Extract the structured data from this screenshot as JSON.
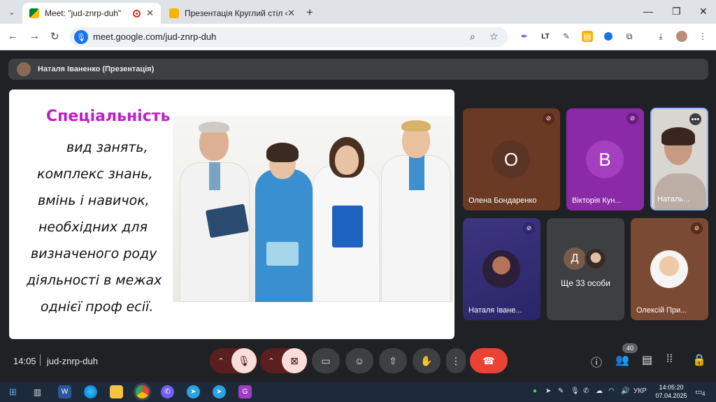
{
  "browser": {
    "tabs": [
      {
        "title": "Meet: \"jud-znrp-duh\"",
        "active": true
      },
      {
        "title": "Презентація Круглий стіл «Мо",
        "active": false
      }
    ],
    "url": "meet.google.com/jud-znrp-duh"
  },
  "meet": {
    "presenter": "Наталя Іваненко (Презентація)",
    "slide": {
      "title": "Спеціальність",
      "lines": [
        "вид занять,",
        "комплекс знань,",
        "вмінь і навичок,",
        "необхідних для",
        "визначеного роду",
        "діяльності в межах",
        "однієї проф есії."
      ]
    },
    "tiles": [
      {
        "name": "Олена Бондаренко",
        "avatar": "О",
        "muted": true
      },
      {
        "name": "Вікторія Кун...",
        "avatar": "В",
        "muted": true
      },
      {
        "name": "Наталь...",
        "muted": false
      },
      {
        "name": "Наталя Іване...",
        "muted": true
      },
      {
        "name": "Ще 33 особи",
        "avatar": "Д"
      },
      {
        "name": "Олексій При...",
        "muted": true
      }
    ],
    "meeting_time": "14:05",
    "meeting_code": "jud-znrp-duh",
    "participants_count": "40"
  },
  "taskbar": {
    "lang": "УКР",
    "time": "14:05:20",
    "date": "07.04.2025",
    "notif_count": "4"
  }
}
